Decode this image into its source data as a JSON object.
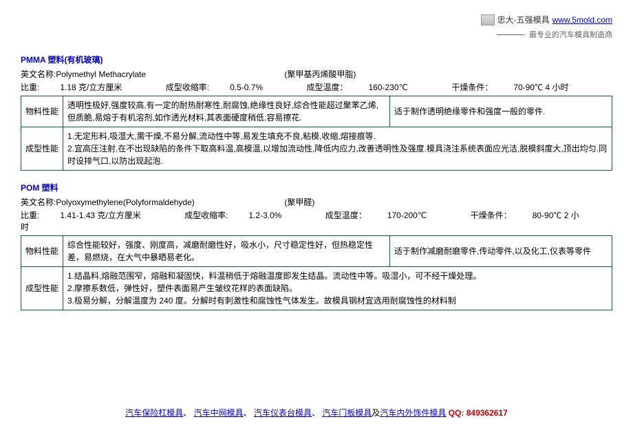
{
  "header": {
    "brand_name": "忠大-五强模具",
    "brand_link": "www.5mold.com",
    "subtitle": "最专业的汽车模具制造商"
  },
  "section1": {
    "title": "PMMA 塑料(有机玻璃)",
    "en_label": "英文名称:",
    "en_name": "Polymethyl Methacrylate",
    "cn_name": "(聚甲基丙烯酸甲脂)",
    "bi_label": "比重:",
    "bi_value": "1.18 克/立方厘米",
    "shrink_label": "成型收缩率:",
    "shrink_value": "0.5-0.7%",
    "temp_label": "成型温度：",
    "temp_value": "160-230℃",
    "dry_label": "干燥条件：",
    "dry_value": "70-90℃  4 小时",
    "row1_header": "物料性能",
    "row1_props": "透明性极好,强度较高,有一定的耐热耐寒性,耐腐蚀,绝缘性良好,综合性能超过聚苯乙烯,但质脆,易熔于有机溶剂,如作透光材料,其表面硬度稍低,容易擦花.",
    "row1_use": "适于制作透明绝缘零件和强度一般的零件.",
    "row2_header": "成型性能",
    "row2_content": "1.无定形料,吸湿大,需干燥,不易分解,流动性中等,易发生填充不良,粘模,收缩,熔接痕等.\n2.宜高压注射,在不出现缺陷的条件下取高料温,高模温,以增加流动性,降低内应力,改善透明性及强度.模具浇注系统表面应光洁,脱模斜度大,顶出均匀.同时设排气口,以防出现起泡."
  },
  "section2": {
    "title": "POM 塑料",
    "en_label": "英文名称:",
    "en_name": "Polyoxymethylene(Polyformaldehyde)",
    "cn_name": "(聚甲醛)",
    "bi_label": "比重:",
    "bi_value": "1.41-1.43 克/立方厘米",
    "shrink_label": "成型收缩率:",
    "shrink_value": "1.2-3.0%",
    "temp_label": "成型温度：",
    "temp_value": "170-200℃",
    "dry_label": "干燥条件：",
    "dry_value": "80-90℃  2 小时",
    "row1_header": "物料性能",
    "row1_props": "综合性能较好，强度、刚度高，减磨耐磨性好，吸水小，尺寸稳定性好，但热稳定性差，易燃烧，在大气中暴晒易老化。",
    "row1_use": "适于制作减磨耐磨零件,传动零件,以及化工,仪表等零件",
    "row2_header": "成型性能",
    "row2_content": "1.结晶料,熔融范围窄，熔融和凝固快，料温稍低于熔融温度即发生结晶。流动性中等。吸湿小，可不经干燥处理。\n2.摩擦系数低，弹性好，塑件表面易产生皱纹花样的表面缺陷。\n3.极易分解，分解温度为 240 度。分解时有刺激性和腐蚀性气体发生。故模具钢材宜选用耐腐蚀性的材料制"
  },
  "footer": {
    "link1": "汽车保险杠模具",
    "link2": "汽车中网模具",
    "link3": "汽车仪表台模具",
    "link4": "汽车门板模具",
    "sep_and": "及",
    "link5": "汽车内外饰件模具",
    "sep_dun": "、",
    "qq_label": "QQ: 849362617"
  }
}
